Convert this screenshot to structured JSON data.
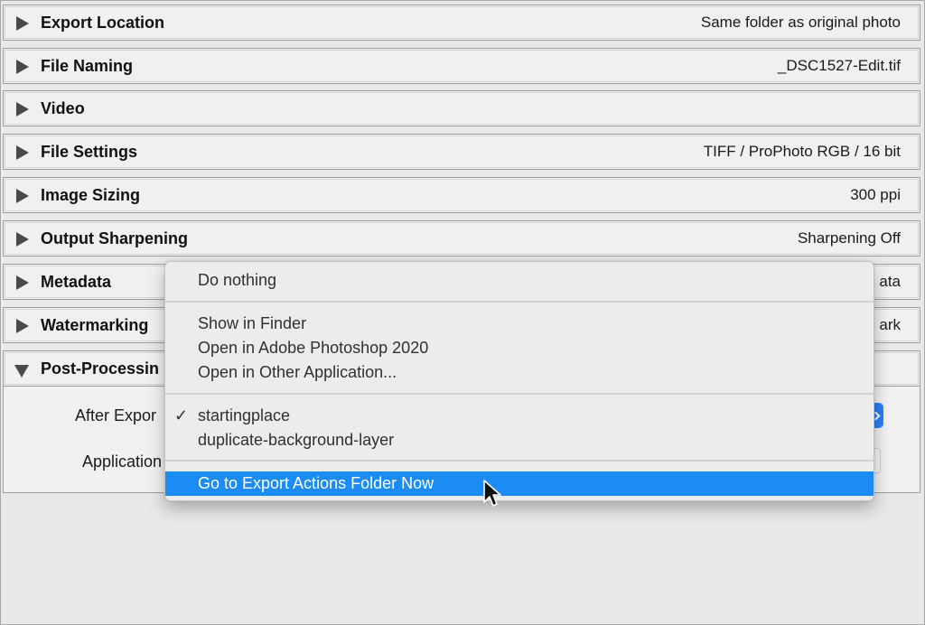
{
  "sections": [
    {
      "title": "Export Location",
      "summary": "Same folder as original photo",
      "expanded": false
    },
    {
      "title": "File Naming",
      "summary": "_DSC1527-Edit.tif",
      "expanded": false
    },
    {
      "title": "Video",
      "summary": "",
      "expanded": false
    },
    {
      "title": "File Settings",
      "summary": "TIFF / ProPhoto RGB / 16 bit",
      "expanded": false
    },
    {
      "title": "Image Sizing",
      "summary": "300 ppi",
      "expanded": false
    },
    {
      "title": "Output Sharpening",
      "summary": "Sharpening Off",
      "expanded": false
    },
    {
      "title": "Metadata",
      "summary": "ata",
      "expanded": false
    },
    {
      "title": "Watermarking",
      "summary": "ark",
      "expanded": false
    },
    {
      "title": "Post-Processin",
      "summary": "",
      "expanded": true
    }
  ],
  "post_processing": {
    "after_export_label": "After Expor",
    "application_label": "Application"
  },
  "menu": {
    "do_nothing": "Do nothing",
    "show_in_finder": "Show in Finder",
    "open_photoshop": "Open in Adobe Photoshop 2020",
    "open_other": "Open in Other Application...",
    "checkmark": "✓",
    "startingplace": "startingplace",
    "duplicate_layer": "duplicate-background-layer",
    "go_to_folder": "Go to Export Actions Folder Now"
  },
  "colors": {
    "highlight": "#1b8cf3",
    "panel": "#f0f0f0",
    "background": "#e8e8e8",
    "popup_button": "#2b7ff5"
  },
  "icons": {
    "collapsed": "triangle-right-icon",
    "expanded": "triangle-down-icon",
    "cursor": "mouse-pointer-icon"
  }
}
